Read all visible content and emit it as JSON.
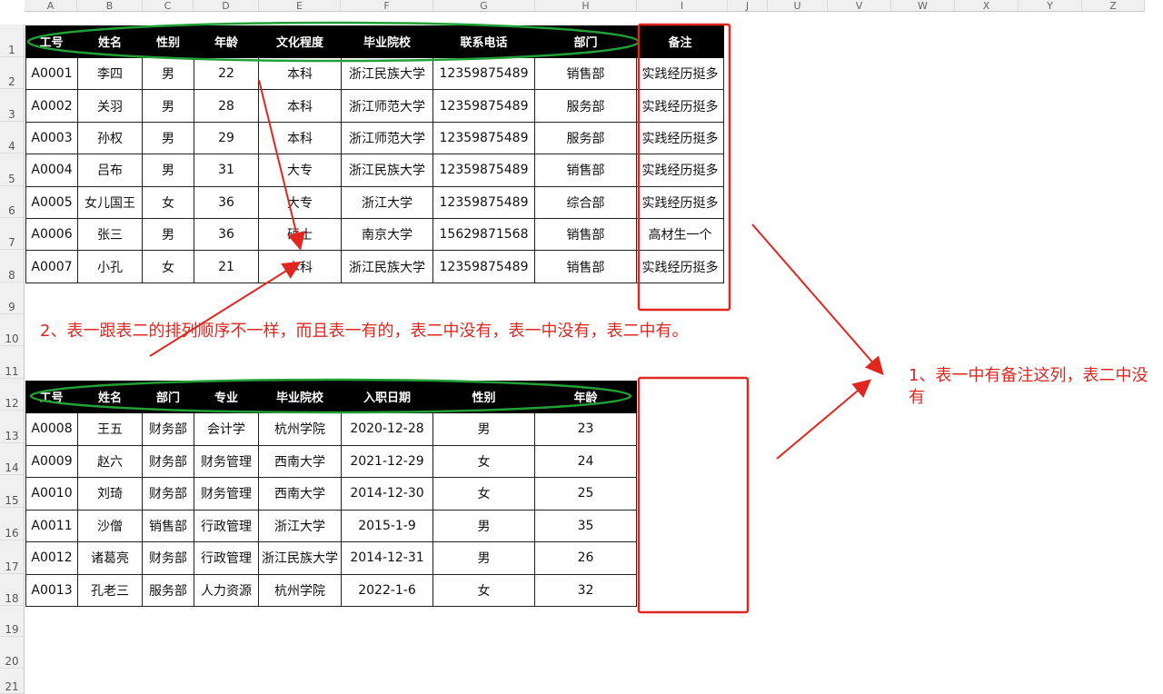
{
  "sheet": {
    "columns": [
      "A",
      "B",
      "C",
      "D",
      "E",
      "F",
      "G",
      "H",
      "I",
      "J",
      "U",
      "V",
      "W",
      "X",
      "Y",
      "Z"
    ],
    "rows": [
      "1",
      "2",
      "3",
      "4",
      "5",
      "6",
      "7",
      "8",
      "9",
      "10",
      "11",
      "12",
      "13",
      "14",
      "15",
      "16",
      "17",
      "18",
      "19",
      "20",
      "21"
    ]
  },
  "table1": {
    "headers": [
      "工号",
      "姓名",
      "性别",
      "年龄",
      "文化程度",
      "毕业院校",
      "联系电话",
      "部门",
      "备注"
    ],
    "rows": [
      [
        "A0001",
        "李四",
        "男",
        "22",
        "本科",
        "浙江民族大学",
        "12359875489",
        "销售部",
        "实践经历挺多"
      ],
      [
        "A0002",
        "关羽",
        "男",
        "28",
        "本科",
        "浙江师范大学",
        "12359875489",
        "服务部",
        "实践经历挺多"
      ],
      [
        "A0003",
        "孙权",
        "男",
        "29",
        "本科",
        "浙江师范大学",
        "12359875489",
        "服务部",
        "实践经历挺多"
      ],
      [
        "A0004",
        "吕布",
        "男",
        "31",
        "大专",
        "浙江民族大学",
        "12359875489",
        "销售部",
        "实践经历挺多"
      ],
      [
        "A0005",
        "女儿国王",
        "女",
        "36",
        "大专",
        "浙江大学",
        "12359875489",
        "综合部",
        "实践经历挺多"
      ],
      [
        "A0006",
        "张三",
        "男",
        "36",
        "硕士",
        "南京大学",
        "15629871568",
        "销售部",
        "高材生一个"
      ],
      [
        "A0007",
        "小孔",
        "女",
        "21",
        "本科",
        "浙江民族大学",
        "12359875489",
        "销售部",
        "实践经历挺多"
      ]
    ]
  },
  "table2": {
    "headers": [
      "工号",
      "姓名",
      "部门",
      "专业",
      "毕业院校",
      "入职日期",
      "性别",
      "年龄"
    ],
    "rows": [
      [
        "A0008",
        "王五",
        "财务部",
        "会计学",
        "杭州学院",
        "2020-12-28",
        "男",
        "23"
      ],
      [
        "A0009",
        "赵六",
        "财务部",
        "财务管理",
        "西南大学",
        "2021-12-29",
        "女",
        "24"
      ],
      [
        "A0010",
        "刘琦",
        "财务部",
        "财务管理",
        "西南大学",
        "2014-12-30",
        "女",
        "25"
      ],
      [
        "A0011",
        "沙僧",
        "销售部",
        "行政管理",
        "浙江大学",
        "2015-1-9",
        "男",
        "35"
      ],
      [
        "A0012",
        "诸葛亮",
        "财务部",
        "行政管理",
        "浙江民族大学",
        "2014-12-31",
        "男",
        "26"
      ],
      [
        "A0013",
        "孔老三",
        "服务部",
        "人力资源",
        "杭州学院",
        "2022-1-6",
        "女",
        "32"
      ]
    ]
  },
  "annotations": {
    "note2": "2、表一跟表二的排列顺序不一样，而且表一有的，表二中没有，表一中没有，表二中有。",
    "note1": "1、表一中有备注这列，表二中没有"
  },
  "colors": {
    "annotation": "#e0261f",
    "ellipse": "#22a036",
    "header_bg": "#000000"
  }
}
